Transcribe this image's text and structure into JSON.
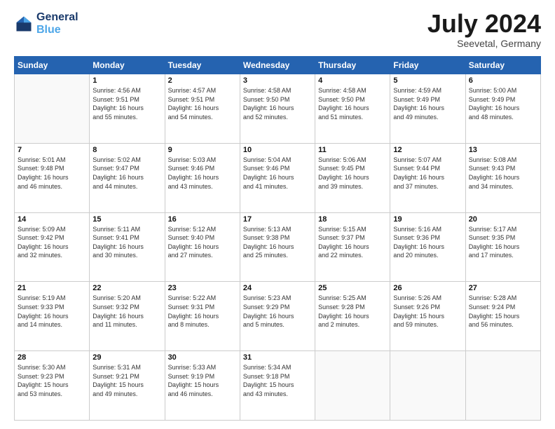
{
  "logo": {
    "line1": "General",
    "line2": "Blue"
  },
  "title": "July 2024",
  "subtitle": "Seevetal, Germany",
  "days_of_week": [
    "Sunday",
    "Monday",
    "Tuesday",
    "Wednesday",
    "Thursday",
    "Friday",
    "Saturday"
  ],
  "weeks": [
    [
      {
        "day": "",
        "info": ""
      },
      {
        "day": "1",
        "info": "Sunrise: 4:56 AM\nSunset: 9:51 PM\nDaylight: 16 hours\nand 55 minutes."
      },
      {
        "day": "2",
        "info": "Sunrise: 4:57 AM\nSunset: 9:51 PM\nDaylight: 16 hours\nand 54 minutes."
      },
      {
        "day": "3",
        "info": "Sunrise: 4:58 AM\nSunset: 9:50 PM\nDaylight: 16 hours\nand 52 minutes."
      },
      {
        "day": "4",
        "info": "Sunrise: 4:58 AM\nSunset: 9:50 PM\nDaylight: 16 hours\nand 51 minutes."
      },
      {
        "day": "5",
        "info": "Sunrise: 4:59 AM\nSunset: 9:49 PM\nDaylight: 16 hours\nand 49 minutes."
      },
      {
        "day": "6",
        "info": "Sunrise: 5:00 AM\nSunset: 9:49 PM\nDaylight: 16 hours\nand 48 minutes."
      }
    ],
    [
      {
        "day": "7",
        "info": "Sunrise: 5:01 AM\nSunset: 9:48 PM\nDaylight: 16 hours\nand 46 minutes."
      },
      {
        "day": "8",
        "info": "Sunrise: 5:02 AM\nSunset: 9:47 PM\nDaylight: 16 hours\nand 44 minutes."
      },
      {
        "day": "9",
        "info": "Sunrise: 5:03 AM\nSunset: 9:46 PM\nDaylight: 16 hours\nand 43 minutes."
      },
      {
        "day": "10",
        "info": "Sunrise: 5:04 AM\nSunset: 9:46 PM\nDaylight: 16 hours\nand 41 minutes."
      },
      {
        "day": "11",
        "info": "Sunrise: 5:06 AM\nSunset: 9:45 PM\nDaylight: 16 hours\nand 39 minutes."
      },
      {
        "day": "12",
        "info": "Sunrise: 5:07 AM\nSunset: 9:44 PM\nDaylight: 16 hours\nand 37 minutes."
      },
      {
        "day": "13",
        "info": "Sunrise: 5:08 AM\nSunset: 9:43 PM\nDaylight: 16 hours\nand 34 minutes."
      }
    ],
    [
      {
        "day": "14",
        "info": "Sunrise: 5:09 AM\nSunset: 9:42 PM\nDaylight: 16 hours\nand 32 minutes."
      },
      {
        "day": "15",
        "info": "Sunrise: 5:11 AM\nSunset: 9:41 PM\nDaylight: 16 hours\nand 30 minutes."
      },
      {
        "day": "16",
        "info": "Sunrise: 5:12 AM\nSunset: 9:40 PM\nDaylight: 16 hours\nand 27 minutes."
      },
      {
        "day": "17",
        "info": "Sunrise: 5:13 AM\nSunset: 9:38 PM\nDaylight: 16 hours\nand 25 minutes."
      },
      {
        "day": "18",
        "info": "Sunrise: 5:15 AM\nSunset: 9:37 PM\nDaylight: 16 hours\nand 22 minutes."
      },
      {
        "day": "19",
        "info": "Sunrise: 5:16 AM\nSunset: 9:36 PM\nDaylight: 16 hours\nand 20 minutes."
      },
      {
        "day": "20",
        "info": "Sunrise: 5:17 AM\nSunset: 9:35 PM\nDaylight: 16 hours\nand 17 minutes."
      }
    ],
    [
      {
        "day": "21",
        "info": "Sunrise: 5:19 AM\nSunset: 9:33 PM\nDaylight: 16 hours\nand 14 minutes."
      },
      {
        "day": "22",
        "info": "Sunrise: 5:20 AM\nSunset: 9:32 PM\nDaylight: 16 hours\nand 11 minutes."
      },
      {
        "day": "23",
        "info": "Sunrise: 5:22 AM\nSunset: 9:31 PM\nDaylight: 16 hours\nand 8 minutes."
      },
      {
        "day": "24",
        "info": "Sunrise: 5:23 AM\nSunset: 9:29 PM\nDaylight: 16 hours\nand 5 minutes."
      },
      {
        "day": "25",
        "info": "Sunrise: 5:25 AM\nSunset: 9:28 PM\nDaylight: 16 hours\nand 2 minutes."
      },
      {
        "day": "26",
        "info": "Sunrise: 5:26 AM\nSunset: 9:26 PM\nDaylight: 15 hours\nand 59 minutes."
      },
      {
        "day": "27",
        "info": "Sunrise: 5:28 AM\nSunset: 9:24 PM\nDaylight: 15 hours\nand 56 minutes."
      }
    ],
    [
      {
        "day": "28",
        "info": "Sunrise: 5:30 AM\nSunset: 9:23 PM\nDaylight: 15 hours\nand 53 minutes."
      },
      {
        "day": "29",
        "info": "Sunrise: 5:31 AM\nSunset: 9:21 PM\nDaylight: 15 hours\nand 49 minutes."
      },
      {
        "day": "30",
        "info": "Sunrise: 5:33 AM\nSunset: 9:19 PM\nDaylight: 15 hours\nand 46 minutes."
      },
      {
        "day": "31",
        "info": "Sunrise: 5:34 AM\nSunset: 9:18 PM\nDaylight: 15 hours\nand 43 minutes."
      },
      {
        "day": "",
        "info": ""
      },
      {
        "day": "",
        "info": ""
      },
      {
        "day": "",
        "info": ""
      }
    ]
  ]
}
